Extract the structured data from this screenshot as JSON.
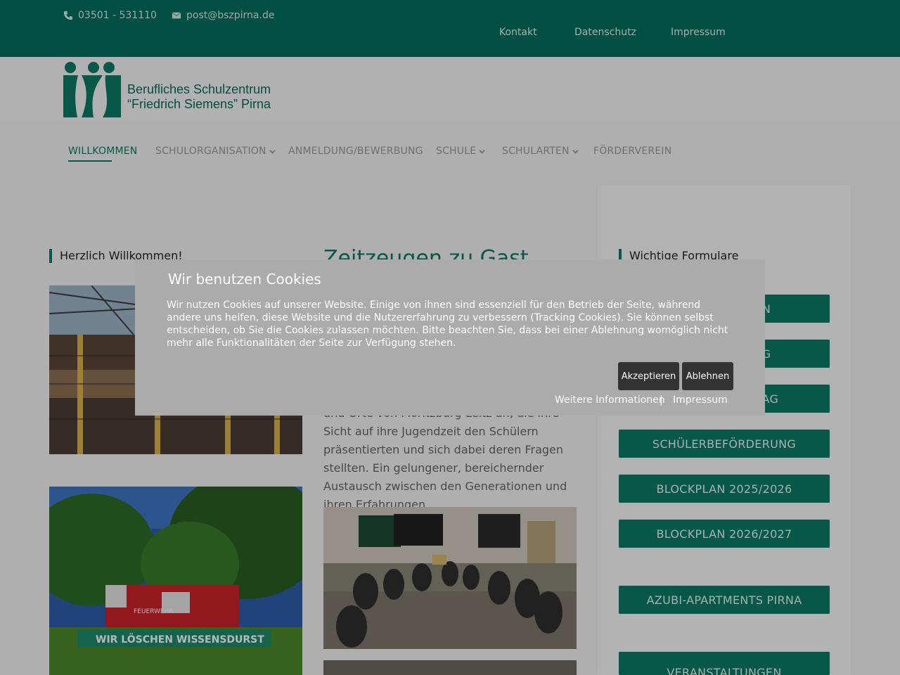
{
  "topbar": {
    "phone": "03501 - 531110",
    "email": "post@bszpirna.de",
    "links": [
      "Kontakt",
      "Datenschutz",
      "Impressum"
    ]
  },
  "logo": {
    "line1": "Berufliches Schulzentrum",
    "line2": "“Friedrich Siemens” Pirna"
  },
  "nav": {
    "items": [
      "WILLKOMMEN",
      "SCHULORGANISATION",
      "ANMELDUNG/BEWERBUNG",
      "SCHULE",
      "SCHULARTEN",
      "FÖRDERVEREIN"
    ]
  },
  "left": {
    "title": "Herzlich Willkommen!",
    "photo2_sign": "WIR LÖSCHEN WISSENSDURST",
    "truck_label": "FEUERWEHR"
  },
  "main": {
    "title": "Zeitzeugen zu Gast",
    "text": "und Orte von Moritzburg-Leitz an, die ihre Sicht auf ihre Jugendzeit den Schülern präsentierten und sich dabei deren Fragen stellten. Ein gelungener, bereichernder Austausch zwischen den Generationen und ihren Erfahrungen."
  },
  "sidebar": {
    "title": "Wichtige Formulare",
    "buttons": [
      "N",
      "G",
      "RAG",
      "SCHÜLERBEFÖRDERUNG",
      "BLOCKPLAN 2025/2026",
      "BLOCKPLAN 2026/2027",
      "AZUBI-APARTMENTS PIRNA",
      "VERANSTALTUNGEN"
    ]
  },
  "cookie": {
    "title": "Wir benutzen Cookies",
    "text": "Wir nutzen Cookies auf unserer Website. Einige von ihnen sind essenziell für den Betrieb der Seite, während andere uns helfen, diese Website und die Nutzererfahrung zu verbessern (Tracking Cookies). Sie können selbst entscheiden, ob Sie die Cookies zulassen möchten. Bitte beachten Sie, dass bei einer Ablehnung womöglich nicht mehr alle Funktionalitäten der Seite zur Verfügung stehen.",
    "accept": "Akzeptieren",
    "decline": "Ablehnen",
    "more_info": "Weitere Informationen",
    "separator": "|",
    "imprint": "Impressum"
  },
  "colors": {
    "brand": "#0a7a66",
    "topbar": "#006e5d",
    "modal": "#ababab",
    "modal_button": "#333333"
  }
}
